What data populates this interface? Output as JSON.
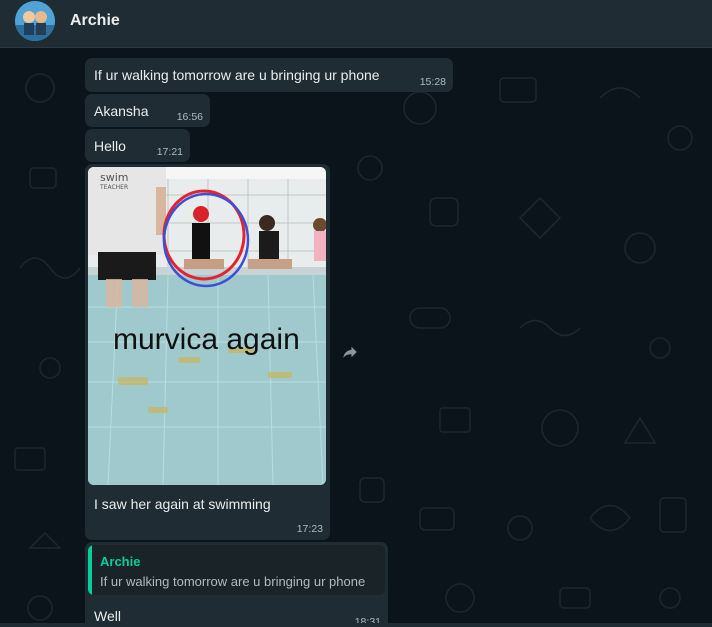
{
  "header": {
    "contact_name": "Archie"
  },
  "messages": [
    {
      "text": "If ur walking tomorrow are u bringing ur phone",
      "time": "15:28"
    },
    {
      "text": "Akansha",
      "time": "16:56"
    },
    {
      "text": "Hello",
      "time": "17:21"
    },
    {
      "image_caption_overlay": "murvica again",
      "image_shirt_text": "swim",
      "image_shirt_subtext": "TEACHER",
      "text": "I saw her again at swimming",
      "time": "17:23"
    },
    {
      "quote": {
        "author": "Archie",
        "text": "If ur walking tomorrow are u bringing ur phone"
      },
      "text": "Well",
      "time": "18:31"
    }
  ],
  "icons": {
    "forward": "forward-arrow-icon",
    "avatar": "contact-avatar"
  },
  "colors": {
    "background": "#0b141a",
    "header": "#202c33",
    "bubble": "#202c33",
    "text": "#e9edef",
    "time": "#aebac1",
    "quote_accent": "#06cf9c"
  }
}
